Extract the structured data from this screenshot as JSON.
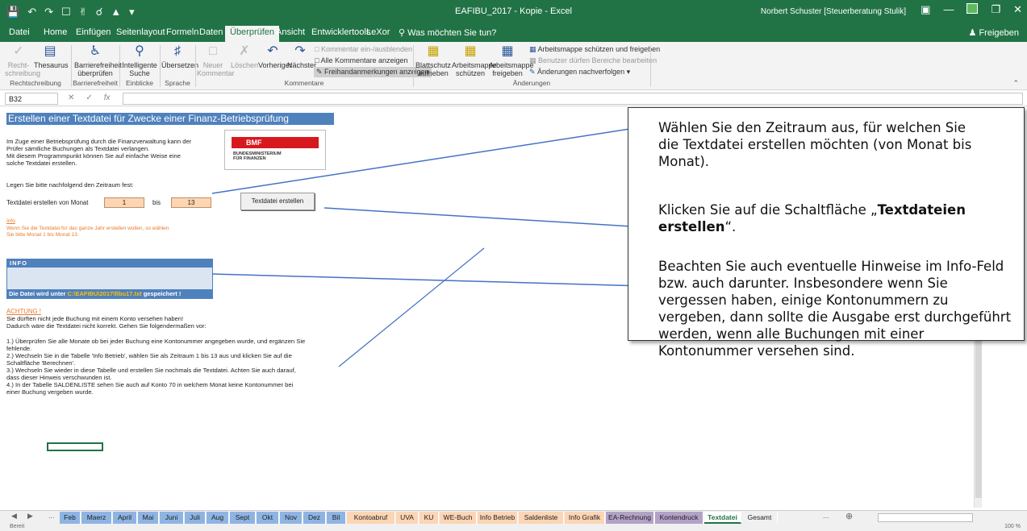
{
  "titlebar": {
    "qat_icons": [
      "save-icon",
      "undo-icon",
      "redo-icon",
      "new-icon",
      "touch-icon",
      "print-preview-icon",
      "open-icon",
      "customize-icon"
    ],
    "title": "EAFIBU_2017 - Kopie - Excel",
    "user": "Norbert Schuster [Steuerberatung Stulik]",
    "window_buttons": [
      "ribbon-display-icon",
      "minimize-icon",
      "maximize-icon",
      "close-icon"
    ]
  },
  "tabs": {
    "items": [
      "Datei",
      "Home",
      "Einfügen",
      "Seitenlayout",
      "Formeln",
      "Daten",
      "Überprüfen",
      "Ansicht",
      "Entwicklertools",
      "LeXor"
    ],
    "active": "Überprüfen",
    "tell_me": "Was möchten Sie tun?",
    "share": "Freigeben"
  },
  "ribbon": {
    "btn_spelling": "Recht-\nschreibung",
    "btn_thesaurus": "Thesaurus",
    "btn_accessibility": "Barrierefreiheit\nüberprüfen",
    "btn_smart_lookup": "Intelligente\nSuche",
    "btn_translate": "Übersetzen",
    "btn_new_comment": "Neuer\nKommentar",
    "btn_delete": "Löschen",
    "btn_previous": "Vorheriger",
    "btn_next": "Nächster",
    "btn_toggle_comments": "Kommentar ein-/ausblenden",
    "btn_show_all_comments": "Alle Kommentare anzeigen",
    "btn_ink": "Freihandanmerkungen anzeigen",
    "btn_unprotect_sheet": "Blattschutz\naufheben",
    "btn_protect_workbook": "Arbeitsmappe\nschützen",
    "btn_share_workbook": "Arbeitsmappe\nfreigeben",
    "btn_protect_share": "Arbeitsmappe schützen und freigeben",
    "btn_allow_ranges": "Benutzer dürfen Bereiche bearbeiten",
    "btn_track_changes": "Änderungen nachverfolgen",
    "group_proofing": "Rechtschreibung",
    "group_accessibility": "Barrierefreiheit",
    "group_insights": "Einblicke",
    "group_language": "Sprache",
    "group_comments": "Kommentare",
    "group_changes": "Änderungen"
  },
  "formula_bar": {
    "name_box": "B32",
    "formula": ""
  },
  "sheet": {
    "header": "Erstellen einer Textdatei für Zwecke einer Finanz-Betriebsprüfung",
    "intro": "Im Zuge einer Betriebsprüfung durch die Finanzverwaltung kann der\nPrüfer sämtliche Buchungen als Textdatei verlangen.\nMit diesem Programmpunkt können Sie auf einfache Weise eine\nsolche Textdatei erstellen.",
    "instruction": "Legen Sie bitte nachfolgend den Zeitraum fest:",
    "from_label": "Textdatei erstellen von Monat",
    "from_value": "1",
    "to_label": "bis",
    "to_value": "13",
    "button_label": "Textdatei erstellen",
    "info_title": "Info",
    "info_text": "Wenn Sie die Textdatei für das ganze Jahr erstellen wollen, so wählen\nSie bitte Monat 1 bis Monat 13.",
    "logo_text": "BMF",
    "logo_subtext": "BUNDESMINISTERIUM\nFÜR FINANZEN",
    "infobox_title": "INFO",
    "infobox_footer_pre": "Die Datei wird unter ",
    "infobox_footer_path": "C:\\EAFIBU\\2017\\fibu17.txt",
    "infobox_footer_post": " gespeichert !",
    "warning_title": "ACHTUNG !",
    "warning_text": "Sie dürften nicht jede Buchung mit einem Konto versehen haben!\nDadurch wäre die Textdatei nicht korrekt. Gehen Sie folgendermaßen vor:",
    "steps": "1.) Überprüfen Sie alle Monate ob bei jeder Buchung eine Kontonummer angegeben wurde, und ergänzen Sie\nfehlende.\n2.) Wechseln Sie in die Tabelle 'Info Betrieb', wählen Sie als Zeitraum 1 bis 13 aus und klicken Sie auf die\nSchaltfläche 'Berechnen'.\n3.) Wechseln Sie wieder in diese Tabelle und erstellen Sie nochmals die Textdatei. Achten Sie auch darauf,\ndass dieser Hinweis verschwunden ist.\n4.) In der Tabelle SALDENLISTE sehen Sie auch auf Konto 70 in welchem Monat keine Kontonummer bei\neiner Buchung vergeben wurde."
  },
  "callout": {
    "p1": "Wählen Sie den Zeitraum aus, für welchen Sie die Textdatei erstellen möchten (von Monat bis Monat).",
    "p2_pre": "Klicken Sie auf die Schaltfläche „",
    "p2_bold": "Textdateien erstellen",
    "p2_post": "“.",
    "p3": "Beachten Sie auch eventuelle Hinweise im Info-Feld bzw. auch darunter. Insbesondere wenn Sie vergessen haben, einige Kontonummern zu vergeben, dann sollte die Ausgabe erst durchgeführt werden, wenn alle Buchungen mit einer Kontonummer versehen sind."
  },
  "sheet_tabs": {
    "ellipsis": "...",
    "items": [
      {
        "label": "Feb",
        "color": "#8eb4e3"
      },
      {
        "label": "Maerz",
        "color": "#8eb4e3"
      },
      {
        "label": "April",
        "color": "#8eb4e3"
      },
      {
        "label": "Mai",
        "color": "#8eb4e3"
      },
      {
        "label": "Juni",
        "color": "#8eb4e3"
      },
      {
        "label": "Juli",
        "color": "#8eb4e3"
      },
      {
        "label": "Aug",
        "color": "#8eb4e3"
      },
      {
        "label": "Sept",
        "color": "#8eb4e3"
      },
      {
        "label": "Okt",
        "color": "#8eb4e3"
      },
      {
        "label": "Nov",
        "color": "#8eb4e3"
      },
      {
        "label": "Dez",
        "color": "#8eb4e3"
      },
      {
        "label": "Bil",
        "color": "#8eb4e3"
      },
      {
        "label": "Kontoabruf",
        "color": "#fcd5b4"
      },
      {
        "label": "UVA",
        "color": "#fcd5b4"
      },
      {
        "label": "KU",
        "color": "#fcd5b4"
      },
      {
        "label": "WE-Buch",
        "color": "#fcd5b4"
      },
      {
        "label": "Info Betrieb",
        "color": "#fcd5b4"
      },
      {
        "label": "Saldenliste",
        "color": "#fcd5b4"
      },
      {
        "label": "Info Grafik",
        "color": "#fcd5b4"
      },
      {
        "label": "EA-Rechnung",
        "color": "#b3a2c7"
      },
      {
        "label": "Kontendruck",
        "color": "#b3a2c7"
      },
      {
        "label": "Textdatei",
        "color": "#ffffff"
      },
      {
        "label": "Gesamt",
        "color": "#f0f0f0"
      }
    ],
    "active": "Textdatei",
    "more": "...",
    "add_icon": "add-sheet-icon"
  },
  "status": {
    "left": "Bereit",
    "zoom": "100 %"
  },
  "colors": {
    "excel_green": "#217346",
    "header_blue": "#4f81bd",
    "input_orange": "#fcd5b4",
    "arrow_blue": "#4472c4",
    "bmf_red": "#d7191f"
  }
}
